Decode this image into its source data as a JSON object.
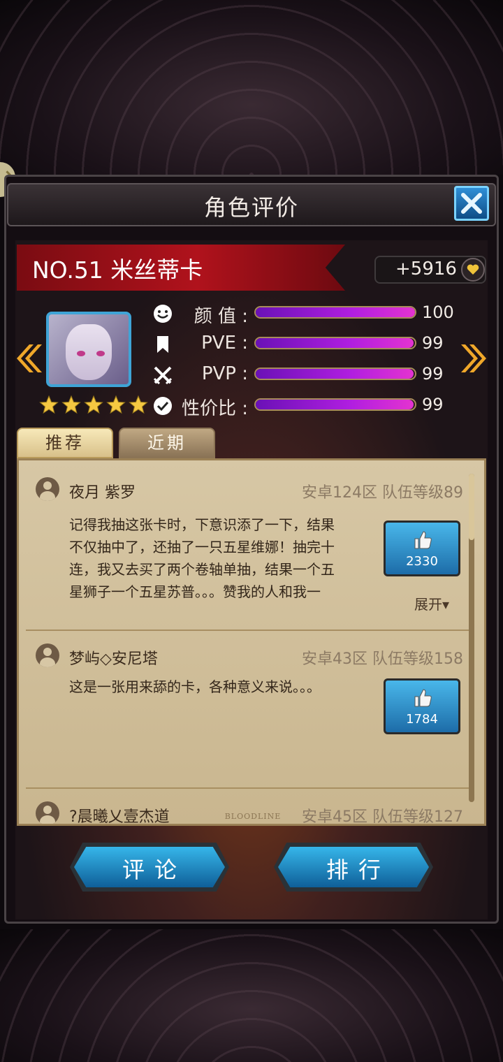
{
  "dialog": {
    "title": "角色评价"
  },
  "character": {
    "name": "NO.51 米丝蒂卡",
    "gold_bonus": "+5916",
    "stars": 5
  },
  "stats": [
    {
      "label": "颜 值 :",
      "value": "100",
      "fill": 1.0,
      "icon": "smile-icon"
    },
    {
      "label": "PVE :",
      "value": "99",
      "fill": 0.99,
      "icon": "bookmark-icon"
    },
    {
      "label": "PVP :",
      "value": "99",
      "fill": 0.99,
      "icon": "crossed-swords-icon"
    },
    {
      "label": "性价比 :",
      "value": "99",
      "fill": 0.99,
      "icon": "check-circle-icon"
    }
  ],
  "tabs": [
    {
      "label": "推荐",
      "active": true
    },
    {
      "label": "近期",
      "active": false
    }
  ],
  "comments": [
    {
      "user": "夜月 紫罗",
      "meta": "安卓124区 队伍等级89",
      "text": "记得我抽这张卡时，下意识添了一下，结果\n不仅抽中了，还抽了一只五星维娜！抽完十\n连，我又去买了两个卷轴单抽，结果一个五\n星狮子一个五星苏普。。。赞我的人和我一",
      "likes": "2330",
      "expand": "展开▾"
    },
    {
      "user": "梦屿◇安尼塔",
      "meta": "安卓43区 队伍等级158",
      "text": "这是一张用来舔的卡，各种意义来说。。。",
      "likes": "1784"
    },
    {
      "user": "?晨曦乂壹杰道",
      "meta": "安卓45区 队伍等级127"
    }
  ],
  "footer_logo": "BLOODLINE",
  "buttons": {
    "comment": "评论",
    "rank": "排行"
  },
  "colors": {
    "accent_blue": "#2f8fd6",
    "stat_purple": "#b01ee0",
    "banner_red": "#b0121c",
    "parchment": "#d7c7a5"
  }
}
